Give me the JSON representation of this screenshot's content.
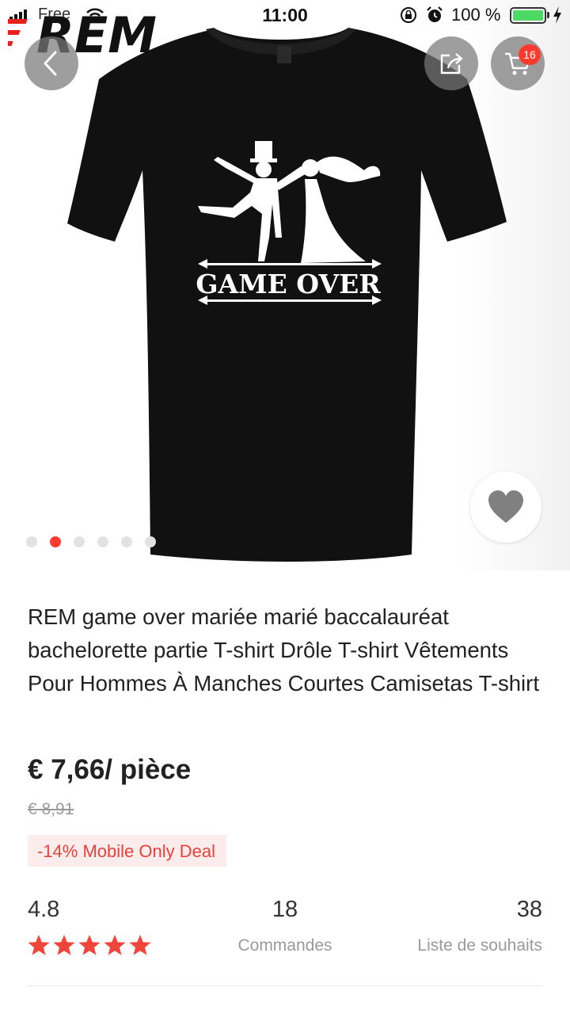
{
  "status_bar": {
    "carrier": "Free",
    "time": "11:00",
    "battery": "100 %"
  },
  "logo": {
    "text": "REM",
    "brand_color": "#e8201c"
  },
  "header": {
    "back_icon": "chevron-left-icon",
    "share_icon": "share-icon",
    "cart_icon": "cart-icon",
    "cart_badge": "16"
  },
  "product_image": {
    "print_text": "GAME OVER",
    "carousel_total": 6,
    "carousel_active": 1
  },
  "product": {
    "title": "REM game over mariée marié baccalauréat bachelorette partie T-shirt Drôle T-shirt Vêtements Pour Hommes À Manches Courtes Camisetas T-shirt",
    "price": "€ 7,66/ pièce",
    "old_price": "€ 8,91",
    "deal": "-14% Mobile Only Deal"
  },
  "stats": {
    "rating": "4.8",
    "rating_stars": 5,
    "orders_count": "18",
    "orders_label": "Commandes",
    "wishlist_count": "38",
    "wishlist_label": "Liste de souhaits"
  },
  "colors": {
    "accent": "#ff3b30",
    "star": "#f0453a",
    "deal_bg": "#fdecec",
    "shirt": "#111111"
  }
}
